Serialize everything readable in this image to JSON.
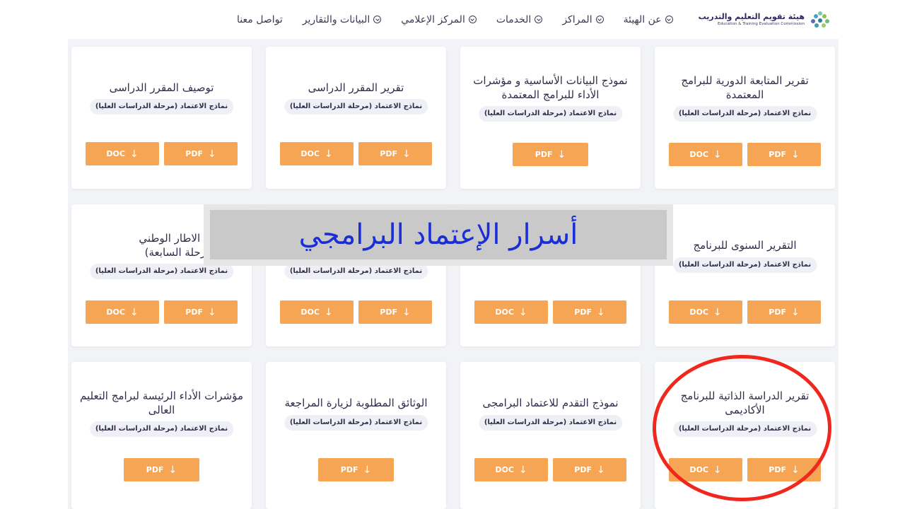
{
  "header": {
    "logo_ar": "هيئة تقويم التعليم والتدريب",
    "logo_en": "Education & Training Evaluation Commission",
    "menu": [
      "عن الهيئة",
      "المراكز",
      "الخدمات",
      "المركز الإعلامي",
      "البيانات والتقارير"
    ],
    "contact": "تواصل معنا"
  },
  "tag": "نماذج الاعتماد (مرحلة الدراسات العليا)",
  "buttons": {
    "pdf": "PDF",
    "doc": "DOC"
  },
  "cards": [
    {
      "title": "تقرير المتابعة الدورية للبرامج المعتمدة"
    },
    {
      "title": "نموذج البيانات الأساسية و مؤشرات الأداء للبرامج المعتمدة"
    },
    {
      "title": "تقرير المقرر الدراسى"
    },
    {
      "title": "توصيف المقرر الدراسى"
    },
    {
      "title": "التقرير السنوى للبرنامج"
    },
    {
      "title": ""
    },
    {
      "title": ""
    },
    {
      "title": "لاتساق مع الاطار الوطني\nهلات (المرحلة السابعة)"
    },
    {
      "title": "تقرير الدراسة الذاتية للبرنامج الأكاديمى"
    },
    {
      "title": "نموذج التقدم للاعتماد البرامجى"
    },
    {
      "title": "الوثائق المطلوبة لزيارة المراجعة"
    },
    {
      "title": "مؤشرات الأداء الرئيسة لبرامج التعليم العالى"
    }
  ],
  "overlay": {
    "text": "أسرار الإعتماد البرامجي"
  },
  "colors": {
    "button": "#f5a553",
    "overlay_text": "#1a2ed8",
    "highlight_circle": "#f0271d"
  }
}
